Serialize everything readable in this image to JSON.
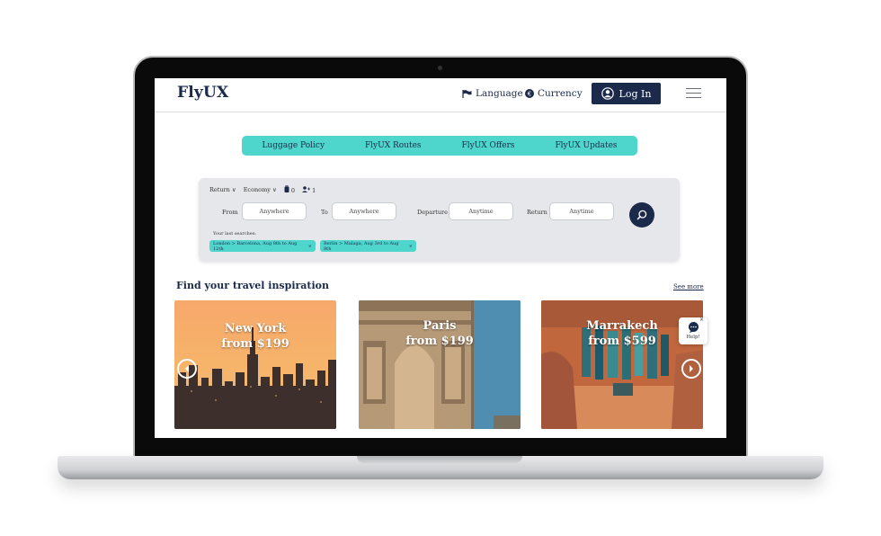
{
  "brand": "FlyUX",
  "header": {
    "language": "Language",
    "currency": "Currency",
    "login": "Log In"
  },
  "nav": [
    "Luggage Policy",
    "FlyUX Routes",
    "FlyUX Offers",
    "FlyUX Updates"
  ],
  "search": {
    "trip_type": "Return",
    "cabin": "Economy",
    "bags": "0",
    "passengers": "1",
    "from_label": "From",
    "from_value": "Anywhere",
    "to_label": "To",
    "to_value": "Anywhere",
    "departure_label": "Departure",
    "departure_value": "Anytime",
    "return_label": "Return",
    "return_value": "Anytime",
    "last_searches_label": "Your last searches:",
    "last_searches": [
      "London > Barcelona, Aug 8th to Aug 12th",
      "Berlin > Malaga, Aug 3rd to Aug 8th"
    ]
  },
  "inspiration": {
    "title": "Find your travel inspiration",
    "see_more": "See more",
    "cards": [
      {
        "city": "New York",
        "price": "from $199"
      },
      {
        "city": "Paris",
        "price": "from $199"
      },
      {
        "city": "Marrakech",
        "price": "from $599"
      }
    ]
  },
  "help": {
    "label": "Help!",
    "close": "×"
  },
  "colors": {
    "navy": "#1b2a4a",
    "teal": "#4ed6cd",
    "panel": "#e6e7ea"
  }
}
